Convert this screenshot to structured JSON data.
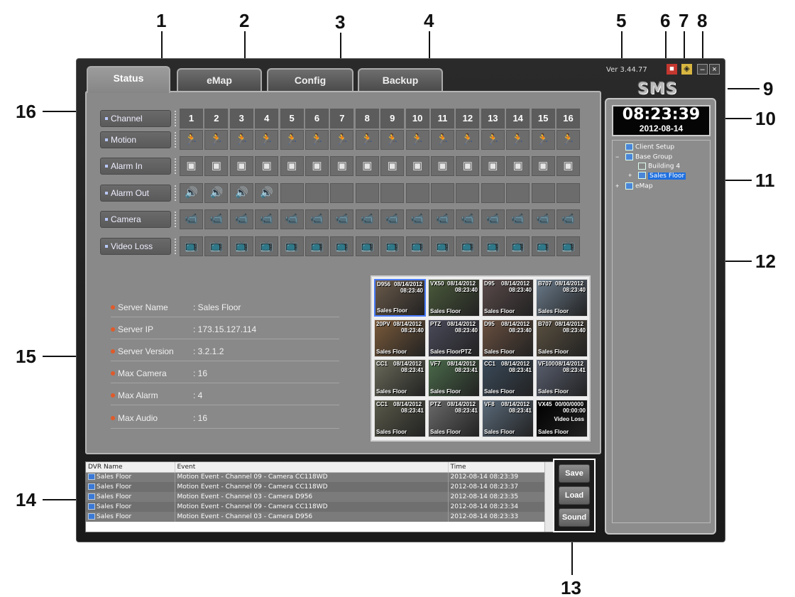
{
  "callouts": [
    "1",
    "2",
    "3",
    "4",
    "5",
    "6",
    "7",
    "8",
    "9",
    "10",
    "11",
    "12",
    "13",
    "14",
    "15",
    "16"
  ],
  "app": {
    "version": "Ver 3.44.77",
    "logo": "SMS",
    "tabs": [
      {
        "label": "Status"
      },
      {
        "label": "eMap"
      },
      {
        "label": "Config"
      },
      {
        "label": "Backup"
      }
    ]
  },
  "status": {
    "rows": [
      {
        "label": "Channel"
      },
      {
        "label": "Motion"
      },
      {
        "label": "Alarm In"
      },
      {
        "label": "Alarm Out"
      },
      {
        "label": "Camera"
      },
      {
        "label": "Video Loss"
      }
    ],
    "channels": [
      "1",
      "2",
      "3",
      "4",
      "5",
      "6",
      "7",
      "8",
      "9",
      "10",
      "11",
      "12",
      "13",
      "14",
      "15",
      "16"
    ],
    "motion_active": [
      9,
      16
    ],
    "alarm_out_count": 4,
    "video_loss_channels": [
      16
    ],
    "colors": {
      "motion_active": "#e8404f",
      "icon_blue": "#3d7ad8"
    }
  },
  "server": {
    "rows": [
      {
        "label": "Server Name",
        "value": ": Sales Floor"
      },
      {
        "label": "Server IP",
        "value": ": 173.15.127.114"
      },
      {
        "label": "Server Version",
        "value": ": 3.2.1.2"
      },
      {
        "label": "Max Camera",
        "value": ": 16"
      },
      {
        "label": "Max Alarm",
        "value": ": 4"
      },
      {
        "label": "Max Audio",
        "value": ": 16"
      }
    ]
  },
  "video": {
    "tiles": [
      {
        "name": "D956",
        "date": "08/14/2012",
        "time": "08:23:40",
        "loc": "Sales Floor",
        "color": "#6a5a4a"
      },
      {
        "name": "VX50",
        "date": "08/14/2012",
        "time": "08:23:40",
        "loc": "Sales Floor",
        "color": "#4a5a3a"
      },
      {
        "name": "D95",
        "date": "08/14/2012",
        "time": "08:23:40",
        "loc": "Sales Floor",
        "color": "#5a4a4a"
      },
      {
        "name": "B707",
        "date": "08/14/2012",
        "time": "08:23:40",
        "loc": "Sales Floor",
        "color": "#6a7a8a"
      },
      {
        "name": "20PV",
        "date": "08/14/2012",
        "time": "08:23:40",
        "loc": "Sales Floor",
        "color": "#7a5a3a"
      },
      {
        "name": "PTZ",
        "date": "08/14/2012",
        "time": "08:23:40",
        "loc": "Sales FloorPTZ",
        "color": "#4a4a5a"
      },
      {
        "name": "D95",
        "date": "08/14/2012",
        "time": "08:23:40",
        "loc": "Sales Floor",
        "color": "#6a5040"
      },
      {
        "name": "B707",
        "date": "08/14/2012",
        "time": "08:23:40",
        "loc": "Sales Floor",
        "color": "#5a5040"
      },
      {
        "name": "CC1",
        "date": "08/14/2012",
        "time": "08:23:41",
        "loc": "Sales Floor",
        "color": "#6a6a5a"
      },
      {
        "name": "VF7",
        "date": "08/14/2012",
        "time": "08:23:41",
        "loc": "Sales Floor",
        "color": "#4a6a4a"
      },
      {
        "name": "CC1",
        "date": "08/14/2012",
        "time": "08:23:41",
        "loc": "Sales Floor",
        "color": "#3a4a5a"
      },
      {
        "name": "VF100",
        "date": "08/14/2012",
        "time": "08:23:41",
        "loc": "Sales Floor",
        "color": "#5a6070"
      },
      {
        "name": "CC1",
        "date": "08/14/2012",
        "time": "08:23:41",
        "loc": "Sales Floor",
        "color": "#5a5a4a"
      },
      {
        "name": "PTZ",
        "date": "08/14/2012",
        "time": "08:23:41",
        "loc": "Sales Floor",
        "color": "#6a6a6a"
      },
      {
        "name": "VF8",
        "date": "08/14/2012",
        "time": "08:23:41",
        "loc": "Sales Floor",
        "color": "#5a6a7a"
      },
      {
        "name": "VX45",
        "date": "00/00/0000",
        "time": "00:00:00",
        "loc": "Sales Floor",
        "lost": "Video Loss",
        "color": "#000000"
      }
    ]
  },
  "log": {
    "headers": [
      "DVR Name",
      "Event",
      "Time"
    ],
    "rows": [
      {
        "dvr": "Sales Floor",
        "event": "Motion Event  -  Channel 09  -  Camera CC118WD",
        "time": "2012-08-14 08:23:39"
      },
      {
        "dvr": "Sales Floor",
        "event": "Motion Event  -  Channel 09  -  Camera CC118WD",
        "time": "2012-08-14 08:23:37"
      },
      {
        "dvr": "Sales Floor",
        "event": "Motion Event  -  Channel 03  -  Camera D956",
        "time": "2012-08-14 08:23:35"
      },
      {
        "dvr": "Sales Floor",
        "event": "Motion Event  -  Channel 09  -  Camera CC118WD",
        "time": "2012-08-14 08:23:34"
      },
      {
        "dvr": "Sales Floor",
        "event": "Motion Event  -  Channel 03  -  Camera D956",
        "time": "2012-08-14 08:23:33"
      }
    ]
  },
  "buttons": {
    "save": "Save",
    "load": "Load",
    "sound": "Sound"
  },
  "clock": {
    "time": "08:23:39",
    "date": "2012-08-14"
  },
  "tree": {
    "client_setup": "Client Setup",
    "base_group": "Base Group",
    "building": "Building 4",
    "sales_floor": "Sales Floor",
    "emap": "eMap"
  }
}
